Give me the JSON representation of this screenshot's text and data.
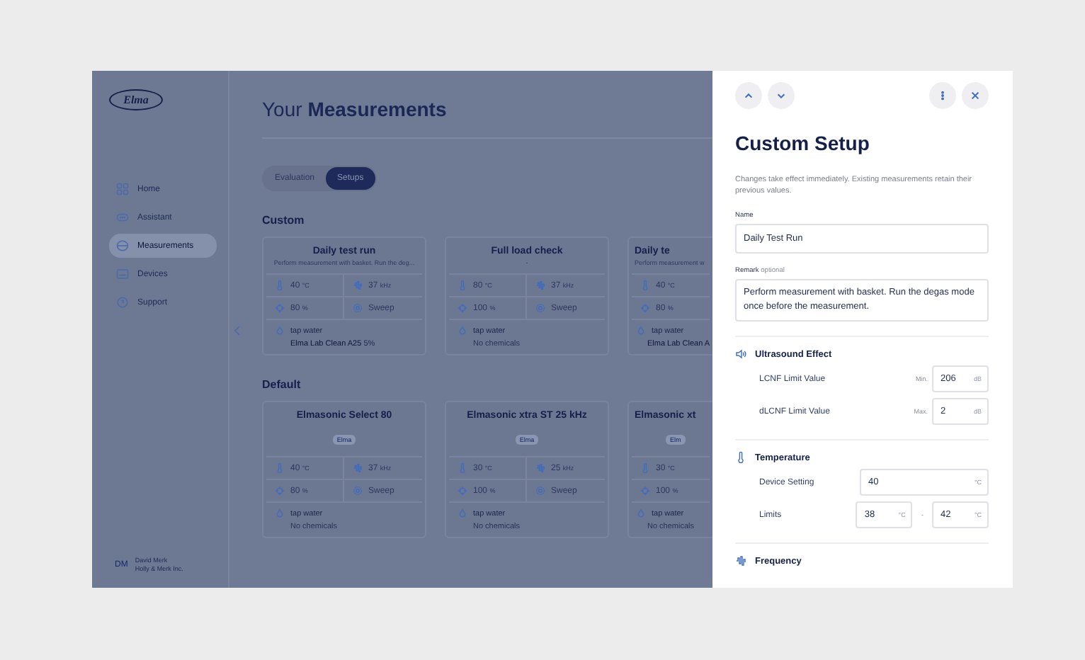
{
  "logo": "Elma",
  "sidebar": {
    "items": [
      {
        "label": "Home",
        "selected": false
      },
      {
        "label": "Assistant",
        "selected": false
      },
      {
        "label": "Measurements",
        "selected": true
      },
      {
        "label": "Devices",
        "selected": false
      },
      {
        "label": "Support",
        "selected": false
      }
    ],
    "user": {
      "initials": "DM",
      "name": "David Merk",
      "company": "Holly & Merk Inc."
    }
  },
  "page": {
    "title_light": "Your",
    "title_bold": "Measurements",
    "tabs": [
      {
        "label": "Evaluation",
        "selected": false
      },
      {
        "label": "Setups",
        "selected": true
      }
    ],
    "sections": [
      {
        "heading": "Custom",
        "cards": [
          {
            "title": "Daily test run",
            "description": "Perform measurement with basket. Run the deg...",
            "temperature": "40",
            "temperature_unit": "°C",
            "frequency": "37",
            "frequency_unit": "kHz",
            "power": "80",
            "power_unit": "%",
            "mode": "Sweep",
            "water": "tap water",
            "chemical": "Elma Lab Clean A25",
            "chemical_amount": "5%",
            "has_chemical": true
          },
          {
            "title": "Full load check",
            "description": "-",
            "temperature": "80",
            "temperature_unit": "°C",
            "frequency": "37",
            "frequency_unit": "kHz",
            "power": "100",
            "power_unit": "%",
            "mode": "Sweep",
            "water": "tap water",
            "chemical": "No chemicals",
            "has_chemical": false
          },
          {
            "title": "Daily te",
            "description": "Perform measurement w",
            "temperature": "40",
            "temperature_unit": "°C",
            "power": "80",
            "power_unit": "%",
            "water": "tap water",
            "chemical": "Elma Lab Clean A",
            "has_chemical": true
          }
        ]
      },
      {
        "heading": "Default",
        "cards": [
          {
            "title": "Elmasonic Select 80",
            "badge": "Elma",
            "temperature": "40",
            "temperature_unit": "°C",
            "frequency": "37",
            "frequency_unit": "kHz",
            "power": "80",
            "power_unit": "%",
            "mode": "Sweep",
            "water": "tap water",
            "chemical": "No chemicals",
            "has_chemical": false
          },
          {
            "title": "Elmasonic xtra ST 25 kHz",
            "badge": "Elma",
            "temperature": "30",
            "temperature_unit": "°C",
            "frequency": "25",
            "frequency_unit": "kHz",
            "power": "100",
            "power_unit": "%",
            "mode": "Sweep",
            "water": "tap water",
            "chemical": "No chemicals",
            "has_chemical": false
          },
          {
            "title": "Elmasonic xt",
            "badge": "Elm",
            "temperature": "30",
            "temperature_unit": "°C",
            "power": "100",
            "power_unit": "%",
            "water": "tap water",
            "chemical": "No chemicals",
            "has_chemical": false
          }
        ]
      }
    ]
  },
  "panel": {
    "title": "Custom Setup",
    "note": "Changes take effect immediately. Existing measurements retain their previous values.",
    "name_label": "Name",
    "name_value": "Daily Test Run",
    "remark_label": "Remark",
    "remark_hint": "optional",
    "remark_value": "Perform measurement with basket. Run the degas mode once before the measurement.",
    "groups": [
      {
        "heading": "Ultrasound Effect",
        "rows": [
          {
            "label": "LCNF Limit Value",
            "kind": "limit",
            "prefix": "Min.",
            "value": "206",
            "unit": "dB"
          },
          {
            "label": "dLCNF Limit Value",
            "kind": "limit",
            "prefix": "Max.",
            "value": "2",
            "unit": "dB"
          }
        ]
      },
      {
        "heading": "Temperature",
        "rows": [
          {
            "label": "Device Setting",
            "kind": "wide",
            "value": "40",
            "unit": "°C"
          },
          {
            "label": "Limits",
            "kind": "range",
            "value": "38",
            "unit": "°C",
            "separator": "-",
            "value_to": "42",
            "unit_to": "°C"
          }
        ]
      },
      {
        "heading": "Frequency"
      }
    ]
  }
}
